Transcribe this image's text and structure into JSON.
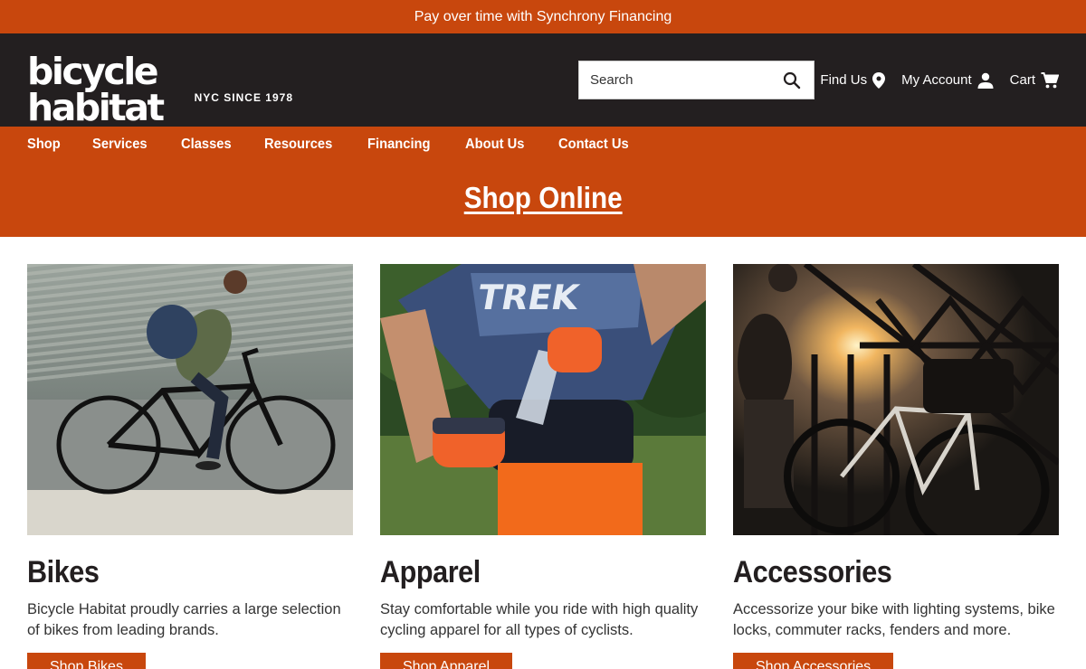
{
  "promo": {
    "text": "Pay over time with Synchrony Financing"
  },
  "header": {
    "logo_text": "bicycle habitat",
    "logo_tagline": "NYC SINCE 1978",
    "search_placeholder": "Search",
    "find_us": "Find Us",
    "my_account": "My Account",
    "cart": "Cart"
  },
  "nav": {
    "items": [
      "Shop",
      "Services",
      "Classes",
      "Resources",
      "Financing",
      "About Us",
      "Contact Us"
    ]
  },
  "hero": {
    "title": "Shop Online"
  },
  "cards": [
    {
      "title": "Bikes",
      "description": "Bicycle Habitat proudly carries a large selection of bikes from leading brands.",
      "button": "Shop Bikes"
    },
    {
      "title": "Apparel",
      "description": "Stay comfortable while you ride with high quality cycling apparel for all types of cyclists.",
      "button": "Shop Apparel"
    },
    {
      "title": "Accessories",
      "description": "Accessorize your bike with lighting systems, bike locks, commuter racks, fenders and more.",
      "button": "Shop Accessories"
    }
  ],
  "colors": {
    "brand_orange": "#c8470d",
    "header_dark": "#231f20"
  },
  "icons": [
    "search-icon",
    "location-pin-icon",
    "account-icon",
    "cart-icon"
  ]
}
